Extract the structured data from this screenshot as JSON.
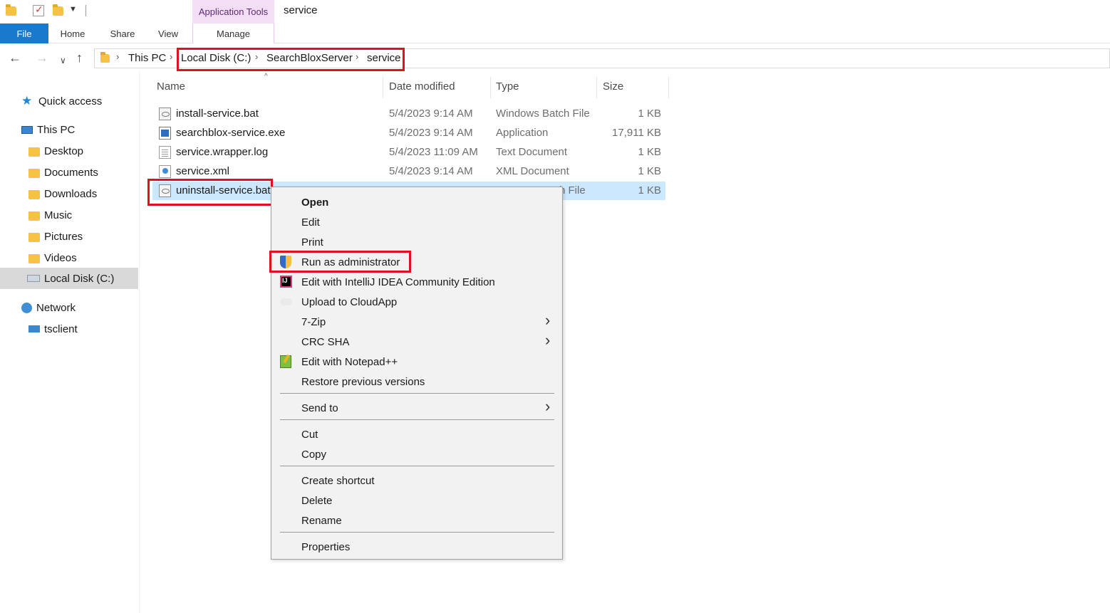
{
  "titlebar": {
    "contextual_tab_group": "Application Tools",
    "window_title": "service"
  },
  "ribbon": {
    "tabs": [
      "File",
      "Home",
      "Share",
      "View",
      "Manage"
    ]
  },
  "address": {
    "breadcrumbs": [
      "This PC",
      "Local Disk (C:)",
      "SearchBloxServer",
      "service"
    ]
  },
  "navpane": {
    "items": [
      {
        "label": "Quick access",
        "icon": "star-icon"
      },
      {
        "label": "This PC",
        "icon": "computer-icon"
      },
      {
        "label": "Desktop",
        "icon": "folder-icon"
      },
      {
        "label": "Documents",
        "icon": "folder-icon"
      },
      {
        "label": "Downloads",
        "icon": "folder-icon"
      },
      {
        "label": "Music",
        "icon": "folder-icon"
      },
      {
        "label": "Pictures",
        "icon": "folder-icon"
      },
      {
        "label": "Videos",
        "icon": "folder-icon"
      },
      {
        "label": "Local Disk (C:)",
        "icon": "disk-icon",
        "selected": true
      },
      {
        "label": "Network",
        "icon": "network-icon"
      },
      {
        "label": "tsclient",
        "icon": "computer-icon"
      }
    ]
  },
  "filelist": {
    "columns": [
      "Name",
      "Date modified",
      "Type",
      "Size"
    ],
    "rows": [
      {
        "name": "install-service.bat",
        "date": "5/4/2023 9:14 AM",
        "type": "Windows Batch File",
        "size": "1 KB",
        "icon": "batch-file-icon"
      },
      {
        "name": "searchblox-service.exe",
        "date": "5/4/2023 9:14 AM",
        "type": "Application",
        "size": "17,911 KB",
        "icon": "exe-file-icon"
      },
      {
        "name": "service.wrapper.log",
        "date": "5/4/2023 11:09 AM",
        "type": "Text Document",
        "size": "1 KB",
        "icon": "text-file-icon"
      },
      {
        "name": "service.xml",
        "date": "5/4/2023 9:14 AM",
        "type": "XML Document",
        "size": "1 KB",
        "icon": "xml-file-icon"
      },
      {
        "name": "uninstall-service.bat",
        "date": "",
        "type": "h File",
        "size": "1 KB",
        "icon": "batch-file-icon",
        "selected": true
      }
    ]
  },
  "context_menu": {
    "items": [
      {
        "label": "Open",
        "bold": true
      },
      {
        "label": "Edit"
      },
      {
        "label": "Print"
      },
      {
        "label": "Run as administrator",
        "icon": "uac-shield-icon"
      },
      {
        "label": "Edit with IntelliJ IDEA Community Edition",
        "icon": "intellij-icon"
      },
      {
        "label": "Upload to CloudApp",
        "icon": "cloud-icon"
      },
      {
        "label": "7-Zip",
        "submenu": true
      },
      {
        "label": "CRC SHA",
        "submenu": true
      },
      {
        "label": "Edit with Notepad++",
        "icon": "notepadpp-icon"
      },
      {
        "label": "Restore previous versions"
      },
      {
        "label": "Send to",
        "submenu": true
      },
      {
        "label": "Cut"
      },
      {
        "label": "Copy"
      },
      {
        "label": "Create shortcut"
      },
      {
        "label": "Delete"
      },
      {
        "label": "Rename"
      },
      {
        "label": "Properties"
      }
    ]
  },
  "colors": {
    "highlight_red": "#e0101f",
    "file_tab_blue": "#1979ca",
    "selection_blue": "#cce8ff",
    "app_tools_pink": "#f3def5"
  }
}
